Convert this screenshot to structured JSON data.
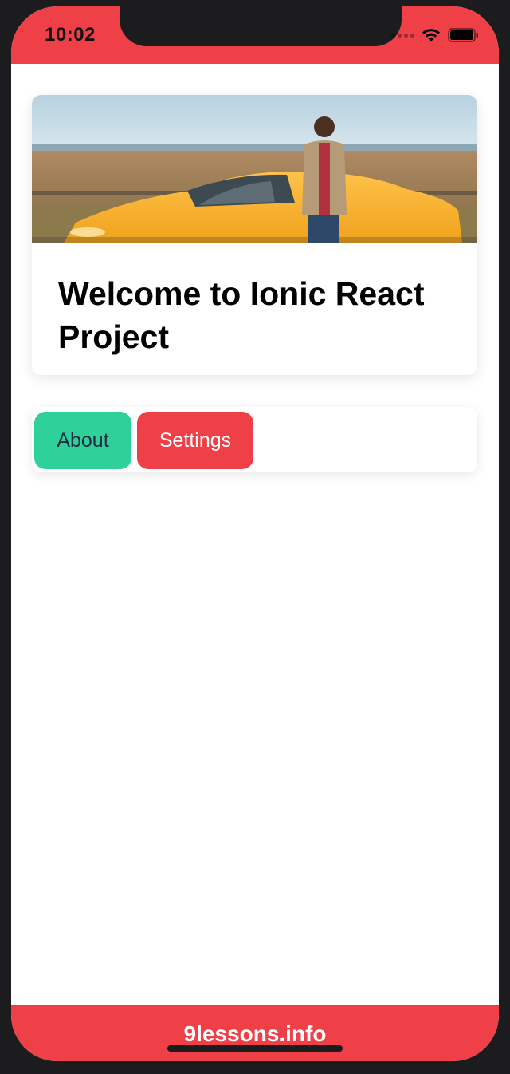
{
  "status_bar": {
    "time": "10:02",
    "icons": [
      "signal-dots-icon",
      "wifi-icon",
      "battery-icon"
    ],
    "color": "#ef4048"
  },
  "card": {
    "title": "Welcome to Ionic React Project",
    "image": "photo of a man standing next to a yellow sports car in a field"
  },
  "buttons": {
    "about_label": "About",
    "about_color": "#2dd199",
    "settings_label": "Settings",
    "settings_color": "#ef4048"
  },
  "footer": {
    "text": "9lessons.info",
    "color": "#ef4048"
  }
}
